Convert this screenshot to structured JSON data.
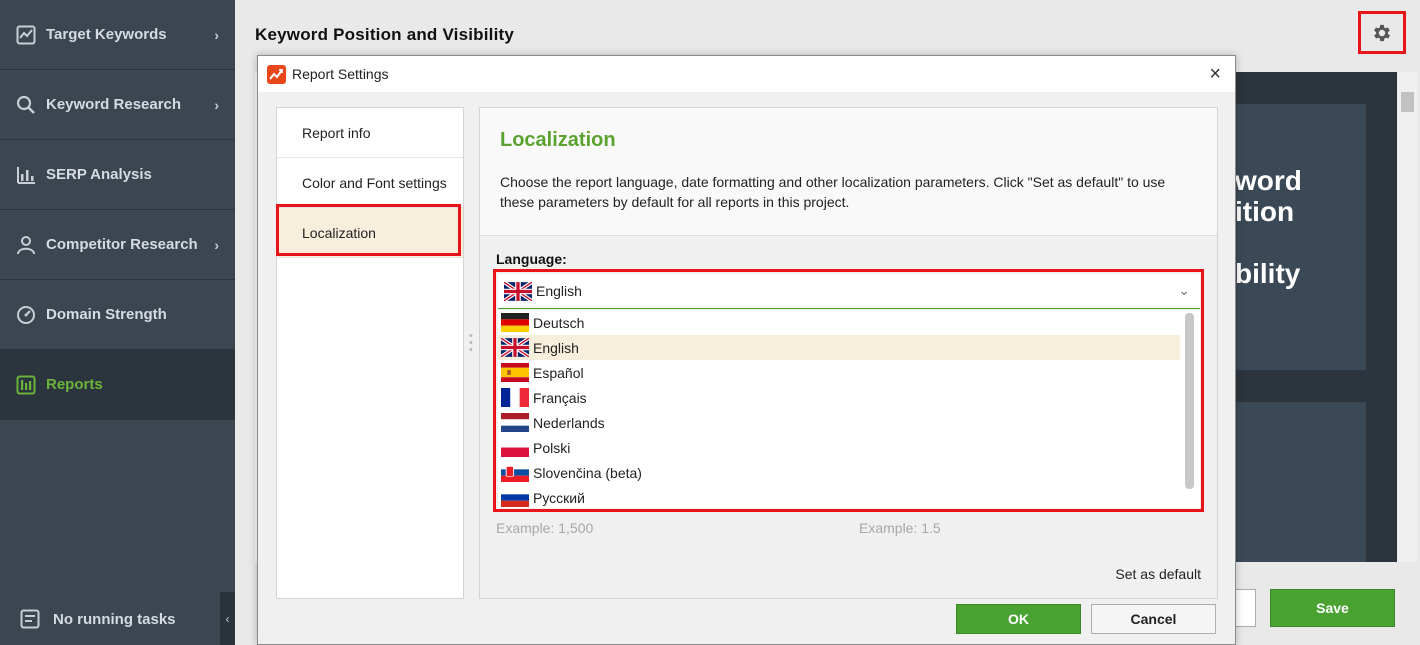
{
  "sidebar": {
    "items": [
      {
        "label": "Target Keywords",
        "icon": "chart-line-icon"
      },
      {
        "label": "Keyword Research",
        "icon": "search-icon"
      },
      {
        "label": "SERP Analysis",
        "icon": "bar-chart-icon"
      },
      {
        "label": "Competitor Research",
        "icon": "user-icon"
      },
      {
        "label": "Domain Strength",
        "icon": "gauge-icon"
      },
      {
        "label": "Reports",
        "icon": "reports-icon"
      }
    ],
    "footer": "No running tasks",
    "collapse": "‹"
  },
  "main": {
    "title": "Keyword Position and Visibility",
    "preview_heading": "word\nition\n\nbility",
    "save": "Save"
  },
  "dialog": {
    "title": "Report Settings",
    "close": "×",
    "tabs": [
      "Report info",
      "Color and Font settings",
      "Localization"
    ],
    "active_tab": "Localization",
    "section_title": "Localization",
    "section_desc": "Choose the report language, date formatting and other localization parameters. Click \"Set as default\" to use these parameters by default for all reports in this project.",
    "language_label": "Language:",
    "selected_language": "English",
    "languages": [
      "Deutsch",
      "English",
      "Español",
      "Français",
      "Nederlands",
      "Polski",
      "Slovenčina (beta)",
      "Русский"
    ],
    "example_left": "Example: 1,500",
    "example_right": "Example: 1.5",
    "set_default": "Set as default",
    "ok": "OK",
    "cancel": "Cancel"
  },
  "colors": {
    "accent_green": "#4aa232",
    "highlight_red": "#e8141a",
    "sidebar_bg": "#3b4651",
    "selected_row": "#f7eedb"
  }
}
